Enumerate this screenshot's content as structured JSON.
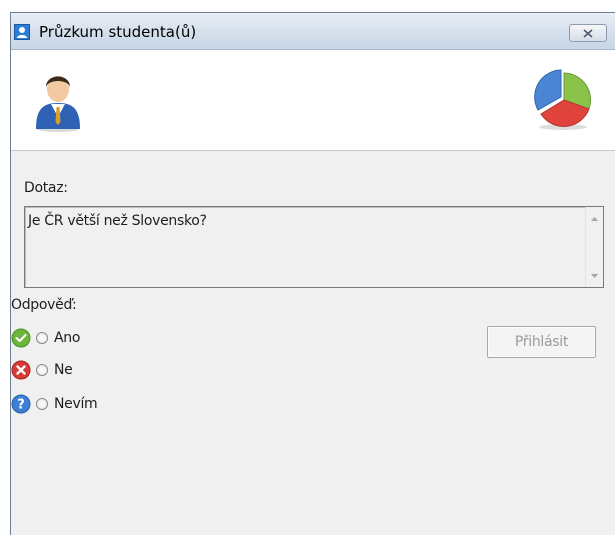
{
  "window": {
    "title": "Průzkum studenta(ů)",
    "app_icon": "student-window-icon",
    "close_icon": "close-icon"
  },
  "header": {
    "left_icon": "student-avatar-icon",
    "right_icon": "pie-chart-icon"
  },
  "question": {
    "label": "Dotaz:",
    "text": "Je ČR větší než Slovensko?"
  },
  "answer": {
    "label": "Odpověď:",
    "options": [
      {
        "label": "Ano",
        "icon": "check-icon",
        "icon_color": "#6ab53a",
        "selected": false
      },
      {
        "label": "Ne",
        "icon": "cross-icon",
        "icon_color": "#d83a36",
        "selected": false
      },
      {
        "label": "Nevím",
        "icon": "question-icon",
        "icon_color": "#3f7fd3",
        "selected": false
      }
    ]
  },
  "submit": {
    "label": "Přihlásit",
    "enabled": false
  }
}
